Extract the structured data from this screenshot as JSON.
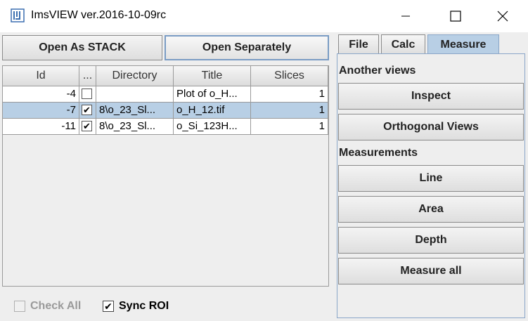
{
  "window": {
    "title": "ImsVIEW ver.2016-10-09rc",
    "controls": [
      "minimize-icon",
      "maximize-icon",
      "close-icon"
    ]
  },
  "toolbar": {
    "open_stack": "Open As STACK",
    "open_separately": "Open Separately"
  },
  "table": {
    "columns": [
      "Id",
      "...",
      "Directory",
      "Title",
      "Slices"
    ],
    "rows": [
      {
        "id": "-4",
        "checked": false,
        "directory": "",
        "title": "Plot of o_H...",
        "slices": "1",
        "selected": false
      },
      {
        "id": "-7",
        "checked": true,
        "directory": "8\\o_23_Sl...",
        "title": "o_H_12.tif",
        "slices": "1",
        "selected": true
      },
      {
        "id": "-11",
        "checked": true,
        "directory": "8\\o_23_Sl...",
        "title": "o_Si_123H...",
        "slices": "1",
        "selected": false
      }
    ]
  },
  "bottom": {
    "check_all": "Check All",
    "sync_roi": "Sync ROI",
    "check_all_checked": false,
    "sync_roi_checked": true
  },
  "tabs": {
    "file": "File",
    "calc": "Calc",
    "measure": "Measure",
    "active": "Measure"
  },
  "measure_panel": {
    "another_views_label": "Another views",
    "inspect": "Inspect",
    "orthogonal_views": "Orthogonal Views",
    "measurements_label": "Measurements",
    "line": "Line",
    "area": "Area",
    "depth": "Depth",
    "measure_all": "Measure all"
  },
  "check_mark": "✔",
  "colors": {
    "selection": "#b8cfe5",
    "tab_active": "#b8cfe5",
    "panel_border": "#8aa6c8"
  }
}
